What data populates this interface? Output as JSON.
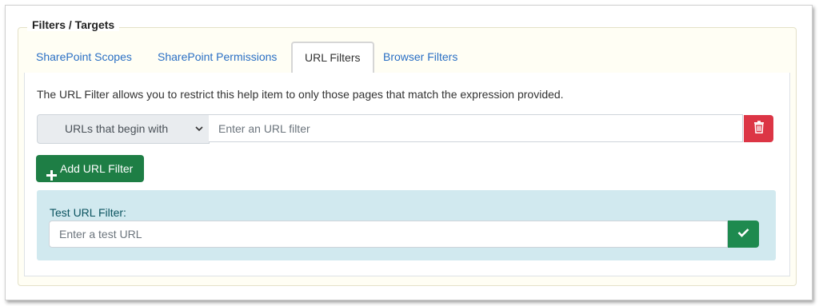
{
  "section": {
    "legend": "Filters / Targets"
  },
  "tabs": [
    {
      "label": "SharePoint Scopes",
      "active": false
    },
    {
      "label": "SharePoint Permissions",
      "active": false
    },
    {
      "label": "URL Filters",
      "active": true
    },
    {
      "label": "Browser Filters",
      "active": false
    }
  ],
  "url_filters": {
    "description": "The URL Filter allows you to restrict this help item to only those pages that match the expression provided.",
    "match_type_selected": "URLs that begin with",
    "filter_value": "",
    "filter_placeholder": "Enter an URL filter",
    "delete_icon": "trash-icon",
    "add_button_label": "Add URL Filter",
    "add_icon": "plus-icon"
  },
  "test": {
    "label": "Test URL Filter:",
    "value": "",
    "placeholder": "Enter a test URL",
    "check_icon": "check-icon"
  },
  "colors": {
    "tab_link": "#2a6fc4",
    "danger": "#dc3545",
    "success": "#1e7e45",
    "info_bg": "#d1e9ef"
  }
}
